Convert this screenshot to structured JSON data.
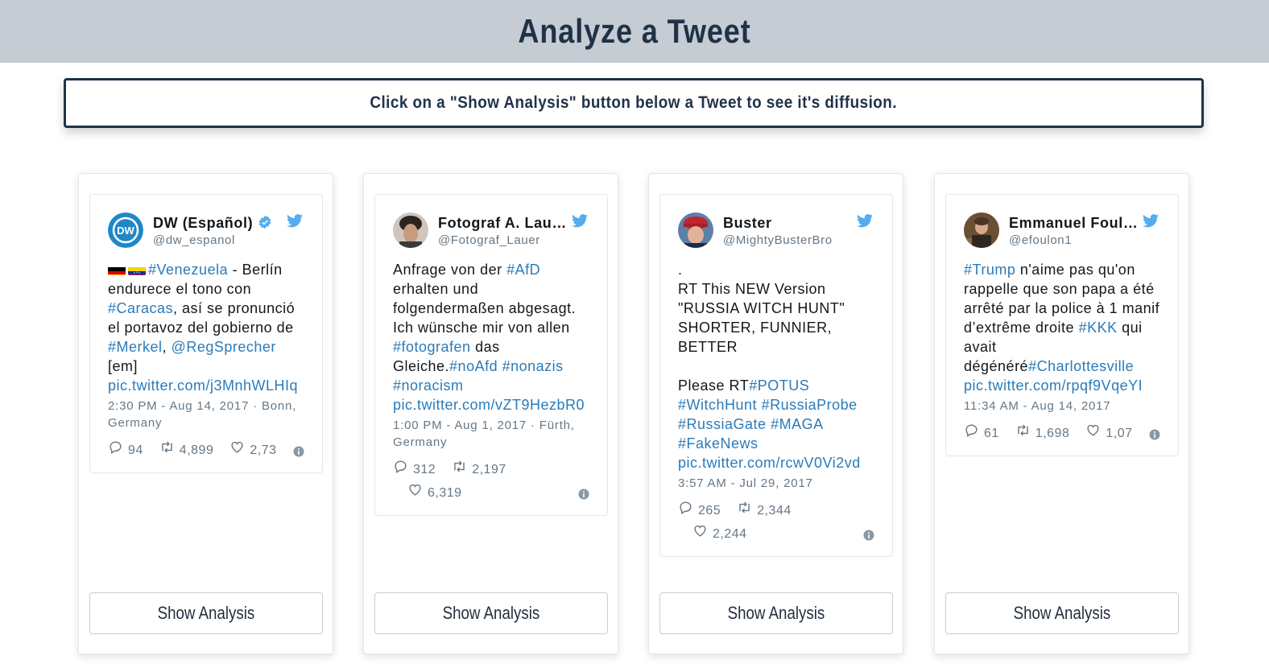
{
  "header": {
    "title": "Analyze a Tweet"
  },
  "instruction": "Click on a \"Show Analysis\" button below a Tweet to see it's diffusion.",
  "button_label": "Show Analysis",
  "tweets": [
    {
      "name": "DW (Español)",
      "handle": "@dw_espanol",
      "verified": true,
      "avatar": "dw-logo",
      "body": [
        {
          "t": "flags",
          "v": ""
        },
        {
          "t": "link",
          "v": "#Venezuela"
        },
        {
          "t": "text",
          "v": " - Berlín endurece el tono con "
        },
        {
          "t": "link",
          "v": "#Caracas"
        },
        {
          "t": "text",
          "v": ", así se pronunció el portavoz del gobierno de "
        },
        {
          "t": "link",
          "v": "#Merkel"
        },
        {
          "t": "text",
          "v": ", "
        },
        {
          "t": "link",
          "v": "@RegSprecher"
        },
        {
          "t": "text",
          "v": " [em] "
        },
        {
          "t": "link",
          "v": "pic.twitter.com/j3MnhWLHIq"
        }
      ],
      "meta": "2:30 PM - Aug 14, 2017 · Bonn, Germany",
      "replies": "94",
      "retweets": "4,899",
      "likes": "2,73"
    },
    {
      "name": "Fotograf A. Lau…",
      "handle": "@Fotograf_Lauer",
      "verified": false,
      "avatar": "photo",
      "body": [
        {
          "t": "text",
          "v": "Anfrage von der "
        },
        {
          "t": "link",
          "v": "#AfD"
        },
        {
          "t": "text",
          "v": " erhalten und folgendermaßen abgesagt. Ich wünsche mir von allen "
        },
        {
          "t": "link",
          "v": "#fotografen"
        },
        {
          "t": "text",
          "v": " das Gleiche."
        },
        {
          "t": "link",
          "v": "#noAfd"
        },
        {
          "t": "text",
          "v": " "
        },
        {
          "t": "link",
          "v": "#nonazis"
        },
        {
          "t": "text",
          "v": " "
        },
        {
          "t": "link",
          "v": "#noracism"
        },
        {
          "t": "text",
          "v": " "
        },
        {
          "t": "link",
          "v": "pic.twitter.com/vZT9HezbR0"
        }
      ],
      "meta": "1:00 PM - Aug 1, 2017 · Fürth, Germany",
      "replies": "312",
      "retweets": "2,197",
      "likes": "6,319"
    },
    {
      "name": "Buster",
      "handle": "@MightyBusterBro",
      "verified": false,
      "avatar": "photo",
      "body": [
        {
          "t": "text",
          "v": ".\nRT This NEW Version \"RUSSIA WITCH HUNT\" SHORTER, FUNNIER, BETTER\n\nPlease RT"
        },
        {
          "t": "link",
          "v": "#POTUS"
        },
        {
          "t": "text",
          "v": " "
        },
        {
          "t": "link",
          "v": "#WitchHunt"
        },
        {
          "t": "text",
          "v": " "
        },
        {
          "t": "link",
          "v": "#RussiaProbe"
        },
        {
          "t": "text",
          "v": " "
        },
        {
          "t": "link",
          "v": "#RussiaGate"
        },
        {
          "t": "text",
          "v": " "
        },
        {
          "t": "link",
          "v": "#MAGA"
        },
        {
          "t": "text",
          "v": " "
        },
        {
          "t": "link",
          "v": "#FakeNews"
        },
        {
          "t": "text",
          "v": " "
        },
        {
          "t": "link",
          "v": "pic.twitter.com/rcwV0Vi2vd"
        }
      ],
      "meta": "3:57 AM - Jul 29, 2017",
      "replies": "265",
      "retweets": "2,344",
      "likes": "2,244"
    },
    {
      "name": "Emmanuel Foul…",
      "handle": "@efoulon1",
      "verified": false,
      "avatar": "photo",
      "body": [
        {
          "t": "link",
          "v": "#Trump"
        },
        {
          "t": "text",
          "v": " n'aime pas qu'on rappelle que son papa a été arrêté par la police à 1 manif d’extrême droite "
        },
        {
          "t": "link",
          "v": "#KKK"
        },
        {
          "t": "text",
          "v": " qui avait dégénéré"
        },
        {
          "t": "link",
          "v": "#Charlottesville"
        },
        {
          "t": "text",
          "v": " "
        },
        {
          "t": "link",
          "v": "pic.twitter.com/rpqf9VqeYI"
        }
      ],
      "meta": "11:34 AM - Aug 14, 2017",
      "replies": "61",
      "retweets": "1,698",
      "likes": "1,07"
    }
  ],
  "colors": {
    "header_bg": "#c6ccd3",
    "title": "#1f3247",
    "link": "#2b7bb9",
    "twitter_blue": "#55acee",
    "muted": "#657786"
  },
  "icons": [
    "twitter-bird-icon",
    "verified-badge-icon",
    "reply-icon",
    "retweet-icon",
    "like-icon",
    "info-icon"
  ]
}
